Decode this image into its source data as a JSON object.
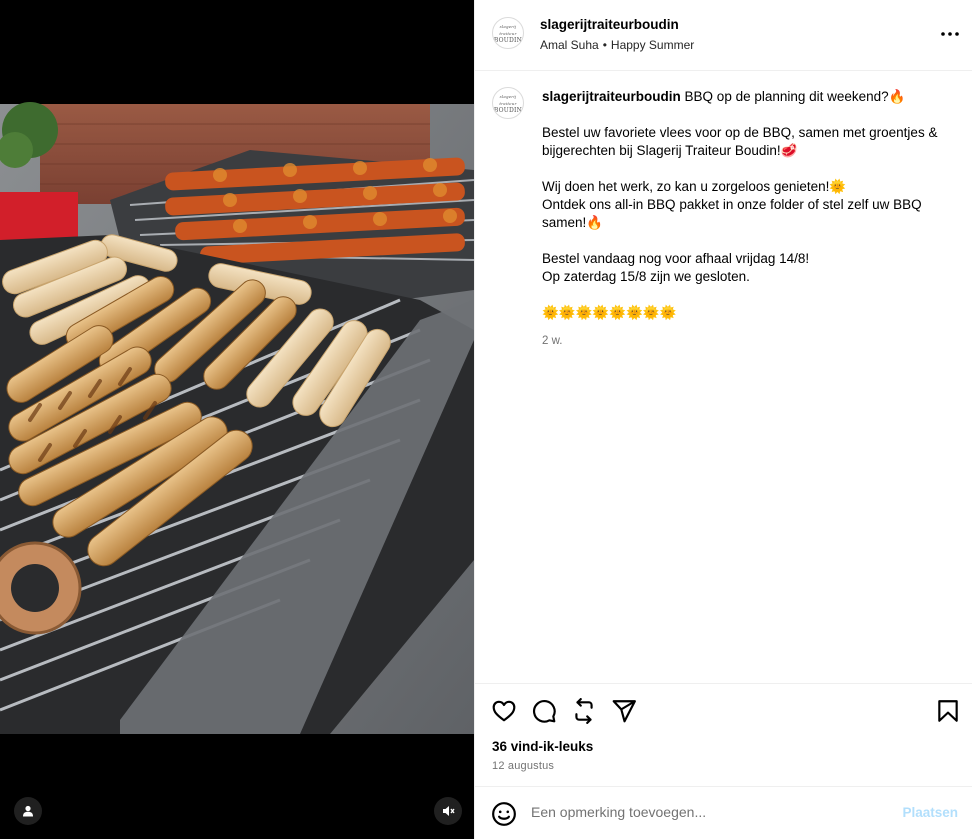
{
  "post": {
    "account": "slagerijtraiteurboudin",
    "avatar_logo_line1": "slagerij traiteur",
    "avatar_logo_line2": "BOUDIN",
    "audio_artist": "Amal Suha",
    "audio_separator": "•",
    "audio_track": "Happy Summer"
  },
  "caption": {
    "username": "slagerijtraiteurboudin",
    "line1": "BBQ op de planning dit weekend?🔥",
    "para2": "Bestel uw favoriete vlees voor op de BBQ, samen met groentjes & bijgerechten bij Slagerij Traiteur Boudin!🥩",
    "para3a": "Wij doen het werk, zo kan u zorgeloos genieten!🌞",
    "para3b": "Ontdek ons all-in BBQ pakket in onze folder of stel zelf uw BBQ samen!🔥",
    "para4a": "Bestel vandaag nog voor afhaal vrijdag 14/8!",
    "para4b": "Op zaterdag 15/8 zijn we gesloten.",
    "suns": "🌞🌞🌞🌞🌞🌞🌞🌞",
    "time_ago": "2 w."
  },
  "stats": {
    "likes": "36 vind-ik-leuks",
    "date": "12 augustus"
  },
  "comment": {
    "placeholder": "Een opmerking toevoegen...",
    "post_label": "Plaatsen"
  },
  "icons": {
    "like": "heart-icon",
    "comment": "comment-icon",
    "repost": "repost-icon",
    "share": "share-icon",
    "save": "bookmark-icon",
    "more": "more-icon",
    "emoji": "emoji-icon",
    "tagged_user": "user-icon",
    "mute": "mute-icon"
  },
  "colors": {
    "post_button_disabled": "#b2dffc",
    "secondary_text": "#737373",
    "divider": "#efefef"
  }
}
